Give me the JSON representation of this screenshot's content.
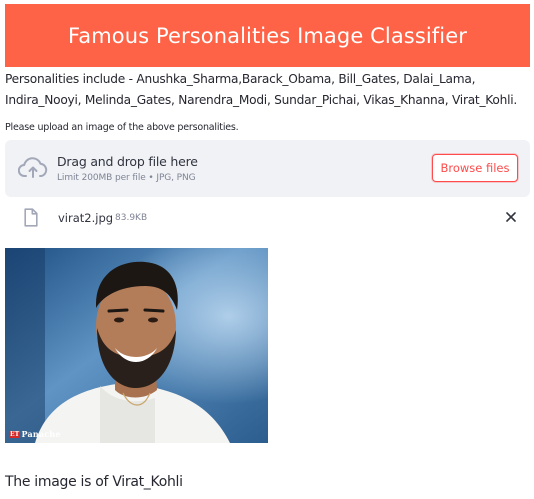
{
  "header": {
    "title": "Famous Personalities Image Classifier",
    "background_color": "#ff6347"
  },
  "intro": {
    "text": "Personalities include - Anushka_Sharma,Barack_Obama, Bill_Gates, Dalai_Lama, Indira_Nooyi, Melinda_Gates, Narendra_Modi, Sundar_Pichai, Vikas_Khanna, Virat_Kohli."
  },
  "uploader": {
    "label": "Please upload an image of the above personalities.",
    "drop_title": "Drag and drop file here",
    "drop_subtitle": "Limit 200MB per file • JPG, PNG",
    "browse_label": "Browse files",
    "upload_icon": "cloud-upload-icon",
    "accent_color": "#ff4b4b"
  },
  "file": {
    "name": "virat2.jpg",
    "size": "83.9KB",
    "file_icon": "file-icon",
    "remove_icon": "close-icon"
  },
  "image": {
    "caption_tag": "ET",
    "caption": "Panache"
  },
  "result": {
    "text": "The image is of Virat_Kohli"
  }
}
